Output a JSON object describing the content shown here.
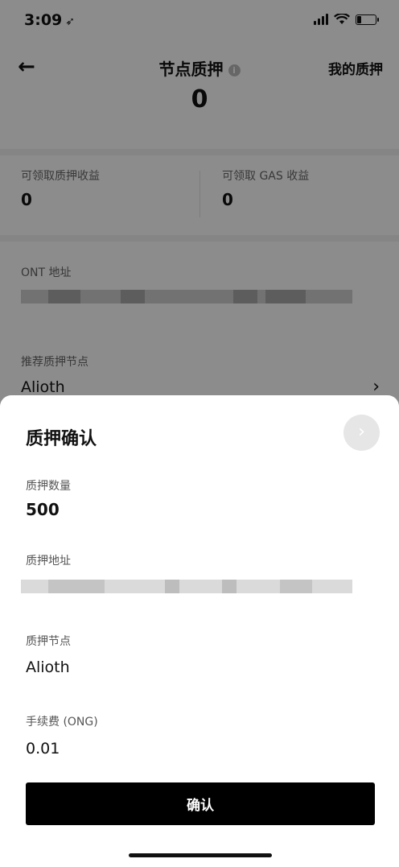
{
  "status_bar": {
    "time": "3:09",
    "location_glyph": "➶"
  },
  "nav": {
    "back_glyph": "←",
    "title": "节点质押",
    "info_glyph": "i",
    "my_stake": "我的质押",
    "total": "0"
  },
  "rewards": {
    "stake_label": "可领取质押收益",
    "stake_value": "0",
    "gas_label": "可领取 GAS 收益",
    "gas_value": "0"
  },
  "address": {
    "label": "ONT 地址"
  },
  "node": {
    "label": "推荐质押节点",
    "name": "Alioth",
    "chevron": "›"
  },
  "sheet": {
    "title": "质押确认",
    "next_glyph": "›",
    "amount_label": "质押数量",
    "amount_value": "500",
    "address_label": "质押地址",
    "node_label": "质押节点",
    "node_value": "Alioth",
    "fee_label": "手续费 (ONG)",
    "fee_value": "0.01",
    "confirm_label": "确认"
  }
}
